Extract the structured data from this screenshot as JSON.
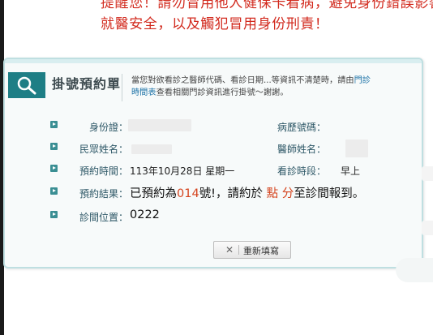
{
  "warning": {
    "line1": "提醒您！請勿冒用他人健保卡看病，避免身份錯誤影響",
    "line2": "就醫安全，以及觸犯冒用身份刑責！"
  },
  "card": {
    "title": "掛號預約單",
    "notice_pre": "當您對欲看診之醫師代碼、看診日期...等資訊不清楚時，請由",
    "notice_link1": "門診",
    "notice_link2": "時間表",
    "notice_post": "查看相關門診資訊進行掛號～謝謝。"
  },
  "fields": {
    "id_label": "身份證：",
    "record_label": "病歷號碼：",
    "name_label": "民眾姓名：",
    "doctor_label": "醫師姓名：",
    "time_label": "預約時間：",
    "time_value": "113年10月28日 星期一",
    "session_label": "看診時段：",
    "session_value": "早上",
    "result_label": "預約結果：",
    "result_pre": "已預約為",
    "result_number": "014",
    "result_mid": "號!，請約於",
    "result_point": "點",
    "result_minute": "分",
    "result_post": "至診間報到。",
    "room_label": "診間位置：",
    "room_value": "0222"
  },
  "buttons": {
    "reset_icon": "close-icon",
    "reset_label": "重新填寫"
  },
  "colors": {
    "warning": "#d22a1e",
    "accent": "#1e7e85",
    "highlight": "#d5441e",
    "link": "#1f74a8"
  }
}
